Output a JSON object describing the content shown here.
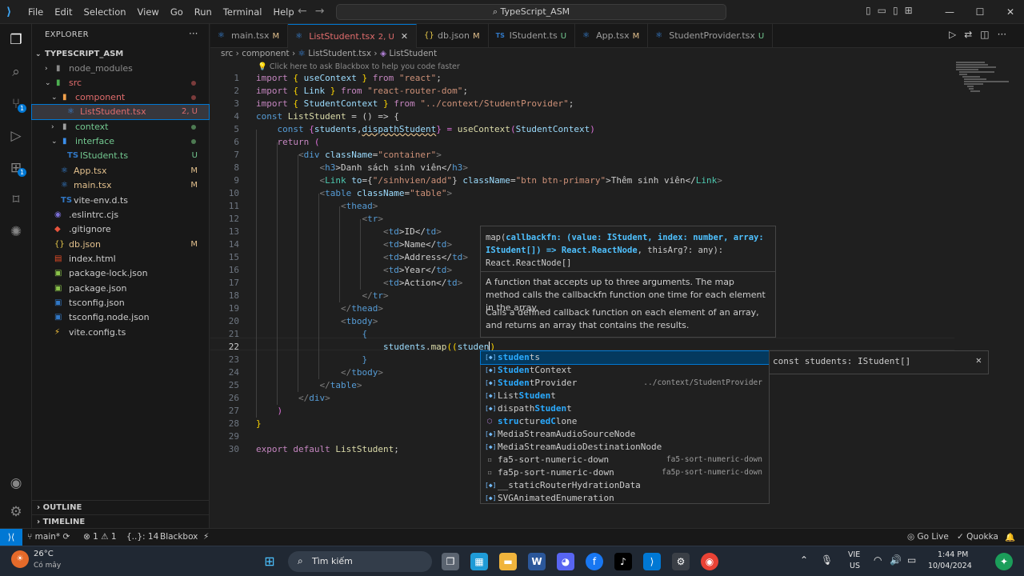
{
  "titlebar": {
    "menu": [
      "File",
      "Edit",
      "Selection",
      "View",
      "Go",
      "Run",
      "Terminal",
      "Help"
    ],
    "command_center": "TypeScript_ASM"
  },
  "explorer": {
    "title": "EXPLORER",
    "root": "TYPESCRIPT_ASM",
    "items": [
      {
        "label": "node_modules",
        "status": ""
      },
      {
        "label": "src",
        "status": ""
      },
      {
        "label": "component",
        "status": ""
      },
      {
        "label": "ListStudent.tsx",
        "status": "2, U"
      },
      {
        "label": "context",
        "status": ""
      },
      {
        "label": "interface",
        "status": ""
      },
      {
        "label": "IStudent.ts",
        "status": "U"
      },
      {
        "label": "App.tsx",
        "status": "M"
      },
      {
        "label": "main.tsx",
        "status": "M"
      },
      {
        "label": "vite-env.d.ts",
        "status": ""
      },
      {
        "label": ".eslintrc.cjs",
        "status": ""
      },
      {
        "label": ".gitignore",
        "status": ""
      },
      {
        "label": "db.json",
        "status": "M"
      },
      {
        "label": "index.html",
        "status": ""
      },
      {
        "label": "package-lock.json",
        "status": ""
      },
      {
        "label": "package.json",
        "status": ""
      },
      {
        "label": "tsconfig.json",
        "status": ""
      },
      {
        "label": "tsconfig.node.json",
        "status": ""
      },
      {
        "label": "vite.config.ts",
        "status": ""
      }
    ],
    "outline": "OUTLINE",
    "timeline": "TIMELINE"
  },
  "tabs": [
    {
      "label": "main.tsx",
      "status": "M"
    },
    {
      "label": "ListStudent.tsx",
      "status": "2, U"
    },
    {
      "label": "db.json",
      "status": "M"
    },
    {
      "label": "IStudent.ts",
      "status": "U"
    },
    {
      "label": "App.tsx",
      "status": "M"
    },
    {
      "label": "StudentProvider.tsx",
      "status": "U"
    }
  ],
  "breadcrumb": {
    "a": "src",
    "b": "component",
    "c": "ListStudent.tsx",
    "d": "ListStudent"
  },
  "hint": "Click here to ask Blackbox to help you code faster",
  "code_lines": [
    "1",
    "2",
    "3",
    "4",
    "5",
    "6",
    "7",
    "8",
    "9",
    "10",
    "11",
    "12",
    "13",
    "14",
    "15",
    "16",
    "17",
    "18",
    "19",
    "20",
    "21",
    "22",
    "23",
    "24",
    "25",
    "26",
    "27",
    "28",
    "29",
    "30"
  ],
  "code": {
    "l1": [
      "import",
      "{ ",
      "useContext",
      " } ",
      "from",
      " ",
      "\"react\"",
      ";"
    ],
    "l2": [
      "import",
      "{ ",
      "Link",
      " } ",
      "from",
      " ",
      "\"react-router-dom\"",
      ";"
    ],
    "l3": [
      "import",
      "{ ",
      "StudentContext",
      " } ",
      "from",
      " ",
      "\"../context/StudentProvider\"",
      ";"
    ],
    "l4": [
      "const",
      " ",
      "ListStudent",
      " = () => {"
    ],
    "l5": [
      "const",
      " {",
      "students",
      ",",
      "dispathStudent",
      "} = ",
      "useContext",
      "(",
      "StudentContext",
      ")"
    ],
    "l6": [
      "return",
      " ("
    ],
    "l7": [
      "<",
      "div",
      " ",
      "className",
      "=",
      "\"container\"",
      ">"
    ],
    "l8": [
      "<",
      "h3",
      ">Danh sách sinh viên</",
      "h3",
      ">"
    ],
    "l9": [
      "<",
      "Link",
      " ",
      "to",
      "={",
      "\"/sinhvien/add\"",
      "} ",
      "className",
      "=",
      "\"btn btn-primary\"",
      ">Thêm sinh viên</",
      "Link",
      ">"
    ],
    "l10": [
      "<",
      "table",
      " ",
      "className",
      "=",
      "\"table\"",
      ">"
    ],
    "l11": [
      "<",
      "thead",
      ">"
    ],
    "l12": [
      "<",
      "tr",
      ">"
    ],
    "l13": [
      "<",
      "td",
      ">ID</",
      "td",
      ">"
    ],
    "l14": [
      "<",
      "td",
      ">Name</",
      "td",
      ">"
    ],
    "l15": [
      "<",
      "td",
      ">Address</",
      "td",
      ">"
    ],
    "l16": [
      "<",
      "td",
      ">Year</",
      "td",
      ">"
    ],
    "l17": [
      "<",
      "td",
      ">Action</",
      "td",
      ">"
    ],
    "l18": [
      "</",
      "tr",
      ">"
    ],
    "l19": [
      "</",
      "thead",
      ">"
    ],
    "l20": [
      "<",
      "tbody",
      ">"
    ],
    "l21": [
      "{"
    ],
    "l22": [
      "students",
      ".",
      "map",
      "((",
      "studen",
      ")"
    ],
    "l23": [
      "}"
    ],
    "l24": [
      "</",
      "tbody",
      ">"
    ],
    "l25": [
      "</",
      "table",
      ">"
    ],
    "l26": [
      "</",
      "div",
      ">"
    ],
    "l27": [
      ")"
    ],
    "l28": [
      "}"
    ],
    "l29": [
      ""
    ],
    "l30": [
      "export",
      " ",
      "default",
      " ",
      "ListStudent",
      ";"
    ]
  },
  "hover": {
    "sig_a": "map(",
    "sig_b": "callbackfn: (value: IStudent, index: number, array: IStudent[]) => React.ReactNode",
    "sig_c": ", thisArg?: any): React.ReactNode[]",
    "doc1": "A function that accepts up to three arguments. The map method calls the callbackfn function one time for each element in the array.",
    "doc2": "Calls a defined callback function on each element of an array, and returns an array that contains the results."
  },
  "suggest": [
    {
      "pre": "",
      "match": "studen",
      "post": "ts",
      "detail": "",
      "icon": "var"
    },
    {
      "pre": "",
      "match": "Studen",
      "post": "tContext",
      "detail": "",
      "icon": "var"
    },
    {
      "pre": "",
      "match": "Studen",
      "post": "tProvider",
      "detail": "../context/StudentProvider",
      "icon": "var"
    },
    {
      "pre": "List",
      "match": "Studen",
      "post": "t",
      "detail": "",
      "icon": "var"
    },
    {
      "pre": "dispath",
      "match": "Studen",
      "post": "t",
      "detail": "",
      "icon": "var"
    },
    {
      "pre": "",
      "match": "stru",
      "post": "ctur",
      "match2": "edC",
      "post2": "lone",
      "detail": "",
      "icon": "fn"
    },
    {
      "pre": "MediaStreamAudioSourceNode",
      "match": "",
      "post": "",
      "detail": "",
      "icon": "var"
    },
    {
      "pre": "MediaStreamAudioDestinationNode",
      "match": "",
      "post": "",
      "detail": "",
      "icon": "var"
    },
    {
      "pre": "fa5-sort-numeric-down",
      "match": "",
      "post": "",
      "detail": "fa5-sort-numeric-down",
      "icon": "txt"
    },
    {
      "pre": "fa5p-sort-numeric-down",
      "match": "",
      "post": "",
      "detail": "fa5p-sort-numeric-down",
      "icon": "txt"
    },
    {
      "pre": "__staticRouterHydrationData",
      "match": "",
      "post": "",
      "detail": "",
      "icon": "var"
    },
    {
      "pre": "SVGAnimatedEnumeration",
      "match": "",
      "post": "",
      "detail": "",
      "icon": "var"
    }
  ],
  "suggest_detail": "const students: IStudent[]",
  "status": {
    "branch": "main*",
    "problems": "⊗ 1 ⚠ 1",
    "selection": "{..}: 14",
    "blackbox": "Blackbox",
    "golive": "Go Live",
    "quokka": "Quokka"
  },
  "taskbar": {
    "weather_temp": "26°C",
    "weather_desc": "Có mây",
    "search": "Tìm kiếm",
    "lang1": "VIE",
    "lang2": "US",
    "time": "1:44 PM",
    "date": "10/04/2024"
  },
  "colors": {
    "accent": "#0078d4",
    "keyword": "#569cd6",
    "string": "#ce9178",
    "variable": "#9cdcfe",
    "function": "#dcdcaa",
    "type": "#4ec9b0"
  }
}
